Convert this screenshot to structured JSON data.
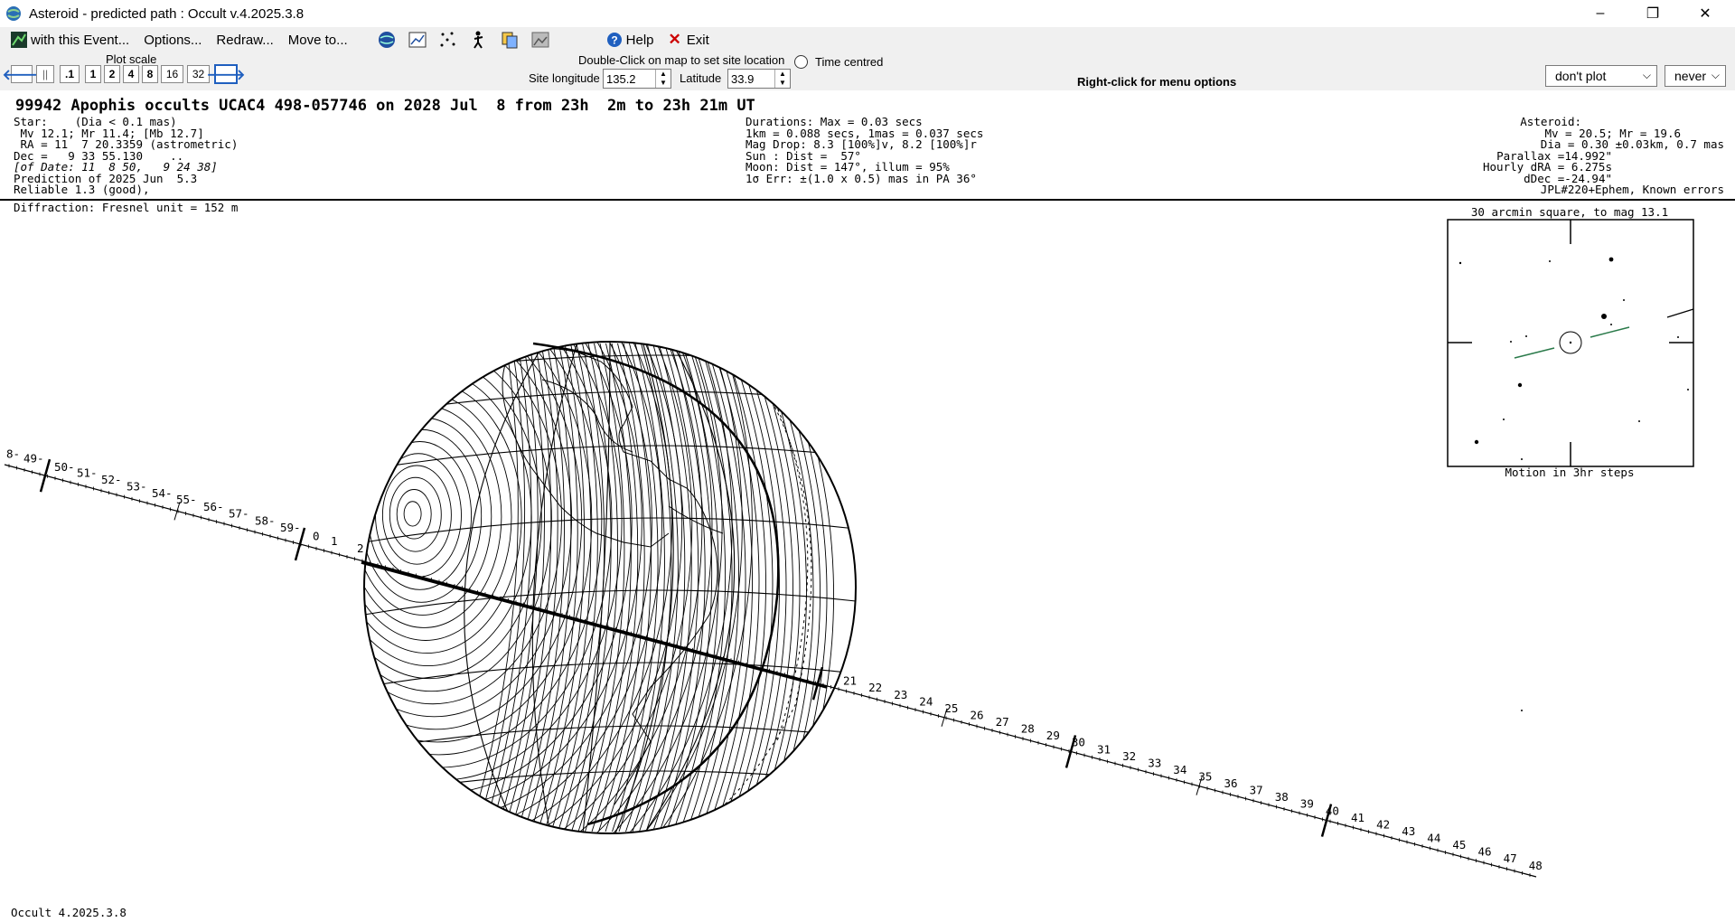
{
  "window": {
    "title": "Asteroid - predicted path : Occult v.4.2025.3.8",
    "controls": [
      "–",
      "❐",
      "✕"
    ]
  },
  "menu": {
    "with_event": "with this Event...",
    "options": "Options...",
    "redraw": "Redraw...",
    "move_to": "Move to...",
    "help": "Help",
    "exit": "Exit"
  },
  "toolbar": {
    "plot_scale_label": "Plot scale",
    "scale_buttons": [
      ".1",
      "1",
      "2",
      "4",
      "8",
      "16",
      "32"
    ],
    "dblclick_hint": "Double-Click on map to set site location",
    "time_centred": "Time centred",
    "site_longitude_label": "Site longitude",
    "site_longitude_value": "135.2",
    "latitude_label": "Latitude",
    "latitude_value": "33.9",
    "right_click_hint": "Right-click for menu options",
    "plot_combo": "don't plot",
    "never_combo": "never"
  },
  "event": {
    "headline": "99942 Apophis occults UCAC4 498-057746 on 2028 Jul  8 from 23h  2m to 23h 21m UT",
    "star_lines": [
      "Star:    (Dia < 0.1 mas)",
      " Mv 12.1; Mr 11.4; [Mb 12.7]",
      " RA = 11  7 20.3359 (astrometric)",
      "Dec =   9 33 55.130    ..",
      "[of Date: 11  8 50,   9 24 38]",
      "Prediction of 2025 Jun  5.3",
      "Reliable 1.3 (good),"
    ],
    "duration_lines": [
      "Durations: Max = 0.03 secs",
      "1km = 0.088 secs, 1mas = 0.037 secs",
      "Mag Drop: 8.3 [100%]v, 8.2 [100%]r",
      "Sun : Dist =  57°",
      "Moon: Dist = 147°, illum = 95%",
      "1σ Err: ±(1.0 x 0.5) mas in PA 36°"
    ],
    "asteroid_lines": [
      "Asteroid:",
      "Mv = 20.5; Mr = 19.6",
      "Dia = 0.30 ±0.03km, 0.7 mas",
      "Parallax =14.992\"",
      "Hourly dRA = 6.275s",
      "dDec =-24.94\"",
      "JPL#220+Ephem, Known errors"
    ],
    "diffraction": "Diffraction: Fresnel unit = 152 m",
    "inset_title": "30 arcmin square, to mag 13.1",
    "inset_caption": "Motion in 3hr steps",
    "footer": "Occult 4.2025.3.8"
  },
  "path_labels": {
    "left": [
      "8-",
      "49-",
      "50-",
      "51-",
      "52-",
      "53-",
      "54-",
      "55-",
      "56-",
      "57-",
      "58-",
      "59-",
      "0",
      "1",
      "2"
    ],
    "right": [
      "21",
      "22",
      "23",
      "24",
      "25",
      "26",
      "27",
      "28",
      "29",
      "30",
      "31",
      "32",
      "33",
      "34",
      "35",
      "36",
      "37",
      "38",
      "39",
      "40",
      "41",
      "42",
      "43",
      "44",
      "45",
      "46",
      "47",
      "48"
    ]
  },
  "colors": {
    "menubar_bg": "#f0f0f0",
    "exit_icon": "#cc0000",
    "help_icon": "#1f5fbf",
    "nav_arrow": "#1f5fbf",
    "motion_line": "#2a7a4a"
  }
}
